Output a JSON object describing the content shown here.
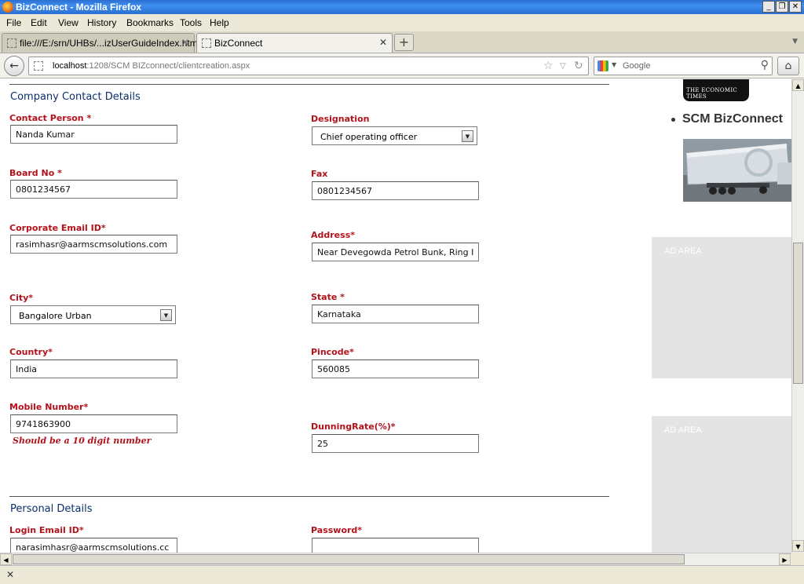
{
  "window": {
    "title": "BizConnect - Mozilla Firefox"
  },
  "menu": [
    "File",
    "Edit",
    "View",
    "History",
    "Bookmarks",
    "Tools",
    "Help"
  ],
  "tabs": [
    {
      "label": "file:///E:/srn/UHBs/...izUserGuideIndex.htm"
    },
    {
      "label": "BizConnect"
    }
  ],
  "nav": {
    "url_host": "localhost",
    "url_rest": ":1208/SCM BIZconnect/clientcreation.aspx",
    "search_placeholder": "Google"
  },
  "sections": {
    "company_contact": "Company Contact Details",
    "personal": "Personal Details"
  },
  "fields": {
    "contact_person": {
      "label": "Contact Person *",
      "value": "Nanda Kumar"
    },
    "designation": {
      "label": "Designation",
      "value": "Chief operating officer"
    },
    "board_no": {
      "label": "Board No *",
      "value": "0801234567"
    },
    "fax": {
      "label": "Fax",
      "value": "0801234567"
    },
    "corporate_email": {
      "label": "Corporate Email ID*",
      "value": "rasimhasr@aarmscmsolutions.com"
    },
    "address": {
      "label": "Address*",
      "value": "Near Devegowda Petrol Bunk, Ring I"
    },
    "city": {
      "label": "City*",
      "value": "Bangalore Urban"
    },
    "state": {
      "label": "State *",
      "value": "Karnataka"
    },
    "country": {
      "label": "Country*",
      "value": "India"
    },
    "pincode": {
      "label": "Pincode*",
      "value": "560085"
    },
    "mobile": {
      "label": "Mobile Number*",
      "value": "9741863900",
      "hint": "Should be a 10 digit number"
    },
    "dunning_rate": {
      "label": "DunningRate(%)*",
      "value": "25"
    },
    "login_email": {
      "label": "Login Email ID*",
      "value": "narasimhasr@aarmscmsolutions.cc"
    },
    "password": {
      "label": "Password*",
      "value": ""
    }
  },
  "sidebar": {
    "logo_caption": "THE ECONOMIC TIMES",
    "brand": "SCM BizConnect",
    "ad_label_1": "AD AREA",
    "ad_label_2": "AD AREA"
  },
  "colors": {
    "label_red": "#b3121b",
    "section_blue": "#0b2f6b",
    "ad_gray": "#e4e4e4"
  }
}
